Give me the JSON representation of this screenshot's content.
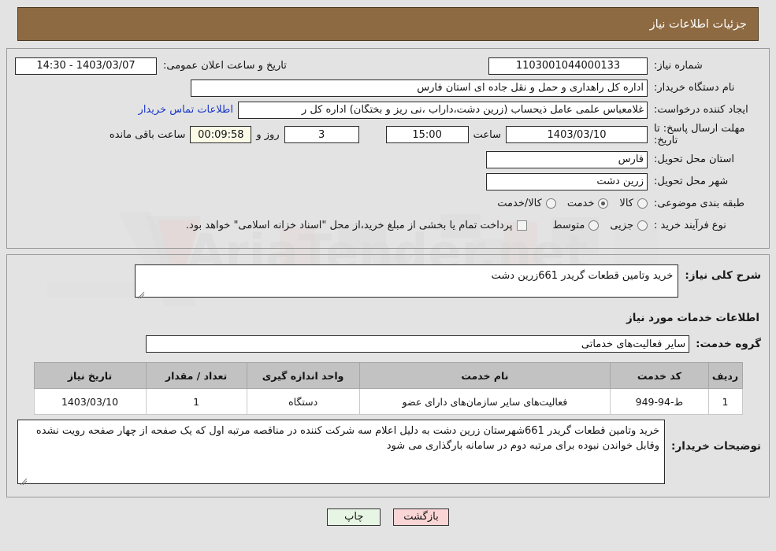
{
  "header": {
    "title": "جزئیات اطلاعات نیاز"
  },
  "form": {
    "need_number_label": "شماره نیاز:",
    "need_number_value": "1103001044000133",
    "announce_label": "تاریخ و ساعت اعلان عمومی:",
    "announce_value": "14:30 - 1403/03/07",
    "buyer_org_label": "نام دستگاه خریدار:",
    "buyer_org_value": "اداره کل راهداری و حمل و نقل جاده ای استان فارس",
    "requester_label": "ایجاد کننده درخواست:",
    "requester_value": "غلامعباس علمی عامل ذیحساب (زرین دشت،داراب ،نی ریز و بختگان) اداره کل ر",
    "contact_link": "اطلاعات تماس خریدار",
    "deadline_label_line1": "مهلت ارسال پاسخ: تا",
    "deadline_label_line2": "تاریخ:",
    "deadline_date": "1403/03/10",
    "hour_label": "ساعت",
    "deadline_time": "15:00",
    "days_value": "3",
    "days_label": "روز و",
    "countdown_value": "00:09:58",
    "remaining_label": "ساعت باقی مانده",
    "province_label": "استان محل تحویل:",
    "province_value": "فارس",
    "city_label": "شهر محل تحویل:",
    "city_value": "زرین دشت",
    "category_label": "طبقه بندی موضوعی:",
    "category_options": [
      {
        "label": "کالا",
        "selected": false
      },
      {
        "label": "خدمت",
        "selected": true
      },
      {
        "label": "کالا/خدمت",
        "selected": false
      }
    ],
    "process_label": "نوع فرآیند خرید :",
    "process_options": [
      {
        "label": "جزیی",
        "selected": false
      },
      {
        "label": "متوسط",
        "selected": false
      }
    ],
    "treasury_checkbox_label": "پرداخت تمام یا بخشی از مبلغ خرید،از محل \"اسناد خزانه اسلامی\" خواهد بود.",
    "treasury_checked": false
  },
  "details": {
    "general_desc_label": "شرح کلی نیاز:",
    "general_desc_value": "خرید وتامین قطعات گریدر 661زرین دشت",
    "services_section_title": "اطلاعات خدمات مورد نیاز",
    "service_group_label": "گروه خدمت:",
    "service_group_value": "سایر فعالیت‌های خدماتی",
    "notes_label": "توضیحات خریدار:",
    "notes_value": "خرید وتامین قطعات گریدر 661شهرستان زرین دشت به دلیل اعلام سه شرکت کننده در مناقصه مرتبه اول که یک صفحه از چهار صفحه رویت نشده وقابل خواندن نبوده برای مرتبه دوم در سامانه بارگذاری می شود"
  },
  "table": {
    "headers": [
      "ردیف",
      "کد خدمت",
      "نام خدمت",
      "واحد اندازه گیری",
      "تعداد / مقدار",
      "تاریخ نیاز"
    ],
    "rows": [
      {
        "radif": "1",
        "code": "ط-94-949",
        "name": "فعالیت‌های سایر سازمان‌های دارای عضو",
        "unit": "دستگاه",
        "qty": "1",
        "date": "1403/03/10"
      }
    ]
  },
  "footer": {
    "print_label": "چاپ",
    "back_label": "بازگشت"
  },
  "watermark": {
    "text": "AriaTender.net"
  },
  "colors": {
    "header_bg": "#8d6a42",
    "page_bg": "#e3e3e3",
    "link": "#1936c8",
    "print_btn": "#e7f6e4",
    "back_btn": "#f9d5d5",
    "table_header": "#c2c2c2"
  }
}
